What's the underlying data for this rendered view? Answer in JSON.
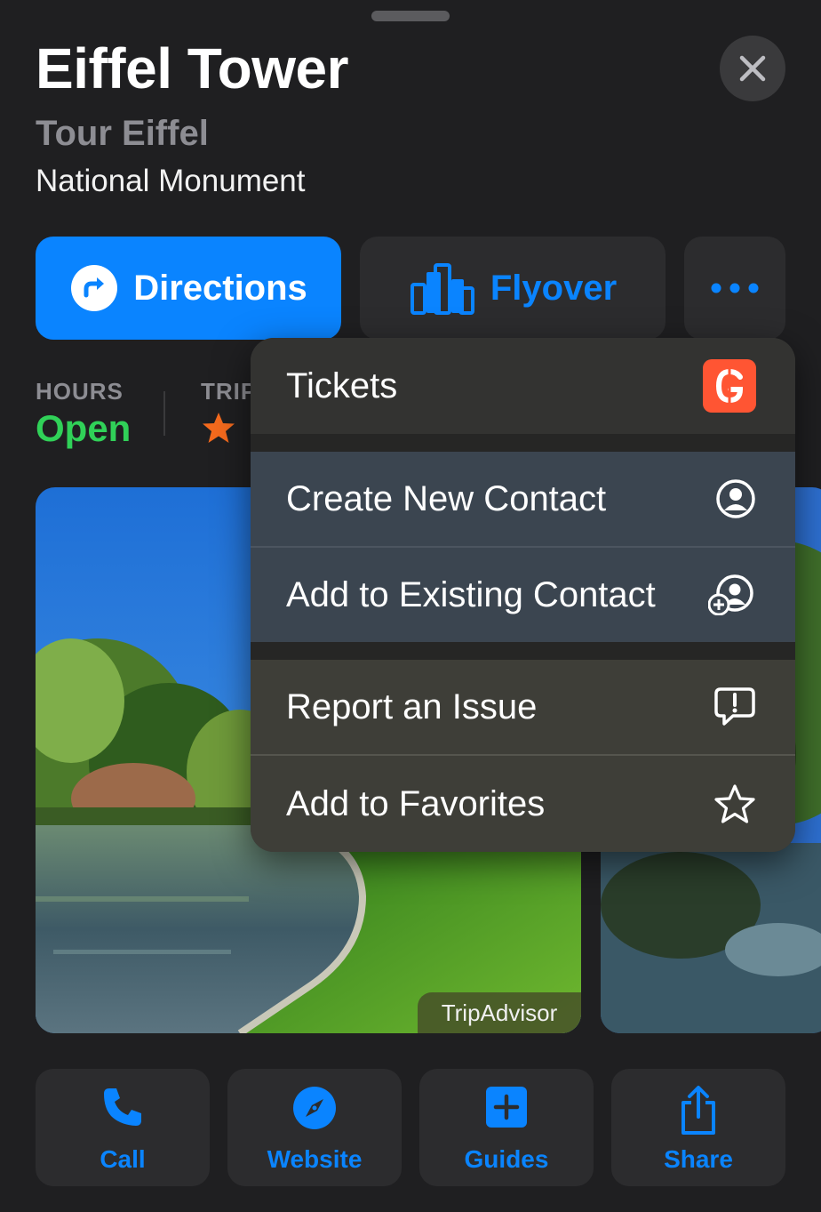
{
  "place": {
    "title": "Eiffel Tower",
    "subtitle": "Tour Eiffel",
    "category": "National Monument"
  },
  "buttons": {
    "directions": "Directions",
    "flyover": "Flyover"
  },
  "info": {
    "hours_label": "HOURS",
    "hours_value": "Open",
    "trip_label": "TRIP"
  },
  "photos": {
    "attribution": "TripAdvisor"
  },
  "menu": {
    "items": [
      {
        "label": "Tickets",
        "icon": "getyourguide-icon"
      },
      {
        "label": "Create New Contact",
        "icon": "person-circle-icon"
      },
      {
        "label": "Add to Existing Contact",
        "icon": "person-add-icon"
      },
      {
        "label": "Report an Issue",
        "icon": "exclamation-bubble-icon"
      },
      {
        "label": "Add to Favorites",
        "icon": "star-icon"
      }
    ]
  },
  "actions": [
    {
      "label": "Call",
      "icon": "phone-icon"
    },
    {
      "label": "Website",
      "icon": "compass-icon"
    },
    {
      "label": "Guides",
      "icon": "plus-square-icon"
    },
    {
      "label": "Share",
      "icon": "share-icon"
    }
  ],
  "colors": {
    "accent": "#0a84ff",
    "open": "#30d158",
    "rating": "#f56a1d",
    "tickets_brand": "#ff5533"
  }
}
